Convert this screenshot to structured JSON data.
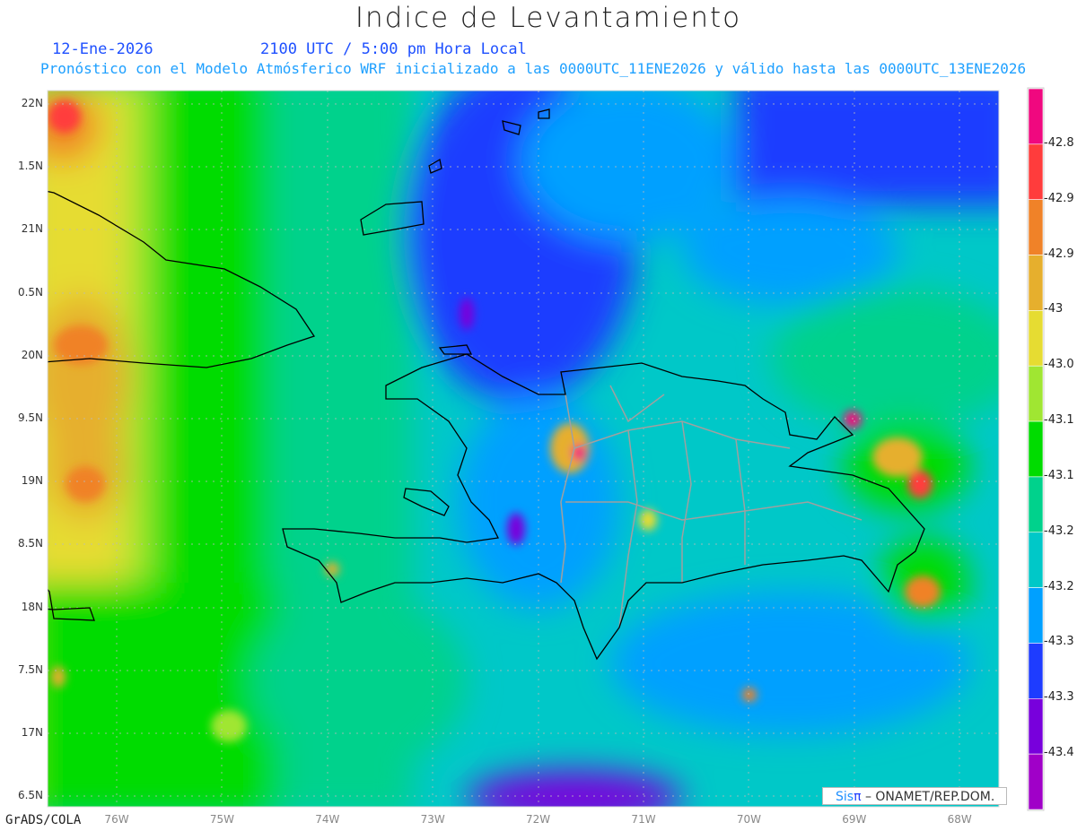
{
  "title": "Indice de Levantamiento",
  "date": "12-Ene-2026",
  "time": "2100 UTC / 5:00 pm Hora Local",
  "subtitle": "Pronóstico con el Modelo Atmósferico WRF inicializado a las 0000UTC_11ENE2026 y válido hasta las  0000UTC_13ENE2026",
  "lat_labels": [
    "22N",
    "1.5N",
    "21N",
    "0.5N",
    "20N",
    "9.5N",
    "19N",
    "8.5N",
    "18N",
    "7.5N",
    "17N",
    "6.5N"
  ],
  "lon_labels": [
    "76W",
    "75W",
    "74W",
    "73W",
    "72W",
    "71W",
    "70W",
    "69W",
    "68W"
  ],
  "colorbar": {
    "colors": [
      "#f0087f",
      "#ff3c3c",
      "#f08228",
      "#e6af2d",
      "#e6dc32",
      "#a0e632",
      "#00dc00",
      "#00d28c",
      "#00c8c8",
      "#00a0ff",
      "#1e3cff",
      "#7800dc",
      "#a000c8"
    ],
    "labels": [
      "-42.8",
      "-42.9",
      "-42.9",
      "-43",
      "-43.0",
      "-43.1",
      "-43.1",
      "-43.2",
      "-43.2",
      "-43.3",
      "-43.3",
      "-43.4"
    ]
  },
  "footer": "GrADS/COLA",
  "credit": {
    "sis": "Sis",
    "pi": "π",
    "rest": " – ONAMET/REP.DOM."
  }
}
